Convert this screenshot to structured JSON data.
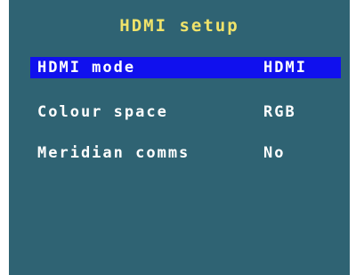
{
  "menu": {
    "title": "HDMI setup",
    "items": [
      {
        "label": "HDMI mode",
        "value": "HDMI",
        "selected": true
      },
      {
        "label": "Colour space",
        "value": "RGB",
        "selected": false
      },
      {
        "label": "Meridian comms",
        "value": "No",
        "selected": false
      }
    ]
  },
  "colors": {
    "background": "#2f6373",
    "title": "#f0e36a",
    "text": "#ffffff",
    "highlight": "#1010ee"
  }
}
